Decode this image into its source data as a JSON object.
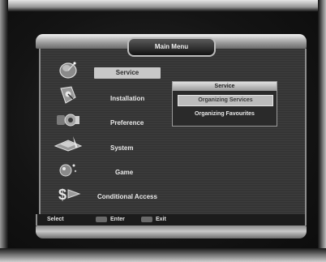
{
  "window": {
    "title": "Main Menu"
  },
  "main_menu": {
    "items": [
      {
        "label": "Service",
        "icon": "satellite-dish-icon",
        "selected": true
      },
      {
        "label": "Installation",
        "icon": "installation-icon",
        "selected": false
      },
      {
        "label": "Preference",
        "icon": "preference-icon",
        "selected": false
      },
      {
        "label": "System",
        "icon": "system-icon",
        "selected": false
      },
      {
        "label": "Game",
        "icon": "game-icon",
        "selected": false
      },
      {
        "label": "Conditional Access",
        "icon": "conditional-access-icon",
        "selected": false
      }
    ]
  },
  "submenu": {
    "title": "Service",
    "items": [
      {
        "label": "Organizing Services",
        "selected": true
      },
      {
        "label": "Organizing Favourites",
        "selected": false
      }
    ]
  },
  "footer": {
    "select_label": "Select",
    "enter_label": "Enter",
    "exit_label": "Exit"
  },
  "colors": {
    "selection": "#c8c8c8",
    "frame": "#a0a0a0",
    "panel": "#353535",
    "text": "#eaeaea"
  }
}
